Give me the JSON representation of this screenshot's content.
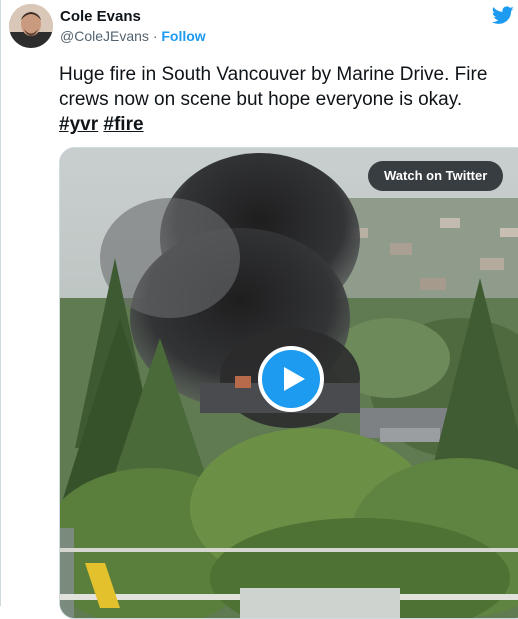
{
  "author": {
    "name": "Cole Evans",
    "handle": "@ColeJEvans",
    "separator": "·",
    "follow_label": "Follow"
  },
  "tweet": {
    "text": "Huge fire in South Vancouver by Marine Drive. Fire crews now on scene but hope everyone is okay.",
    "hashtags": [
      "#yvr",
      "#fire"
    ]
  },
  "media": {
    "watch_label": "Watch on Twitter"
  },
  "icons": {
    "brand": "twitter-bird-icon",
    "play": "play-icon"
  },
  "colors": {
    "accent": "#1d9bf0",
    "text": "#0f1419",
    "muted": "#536471",
    "border": "#cfd9de"
  }
}
